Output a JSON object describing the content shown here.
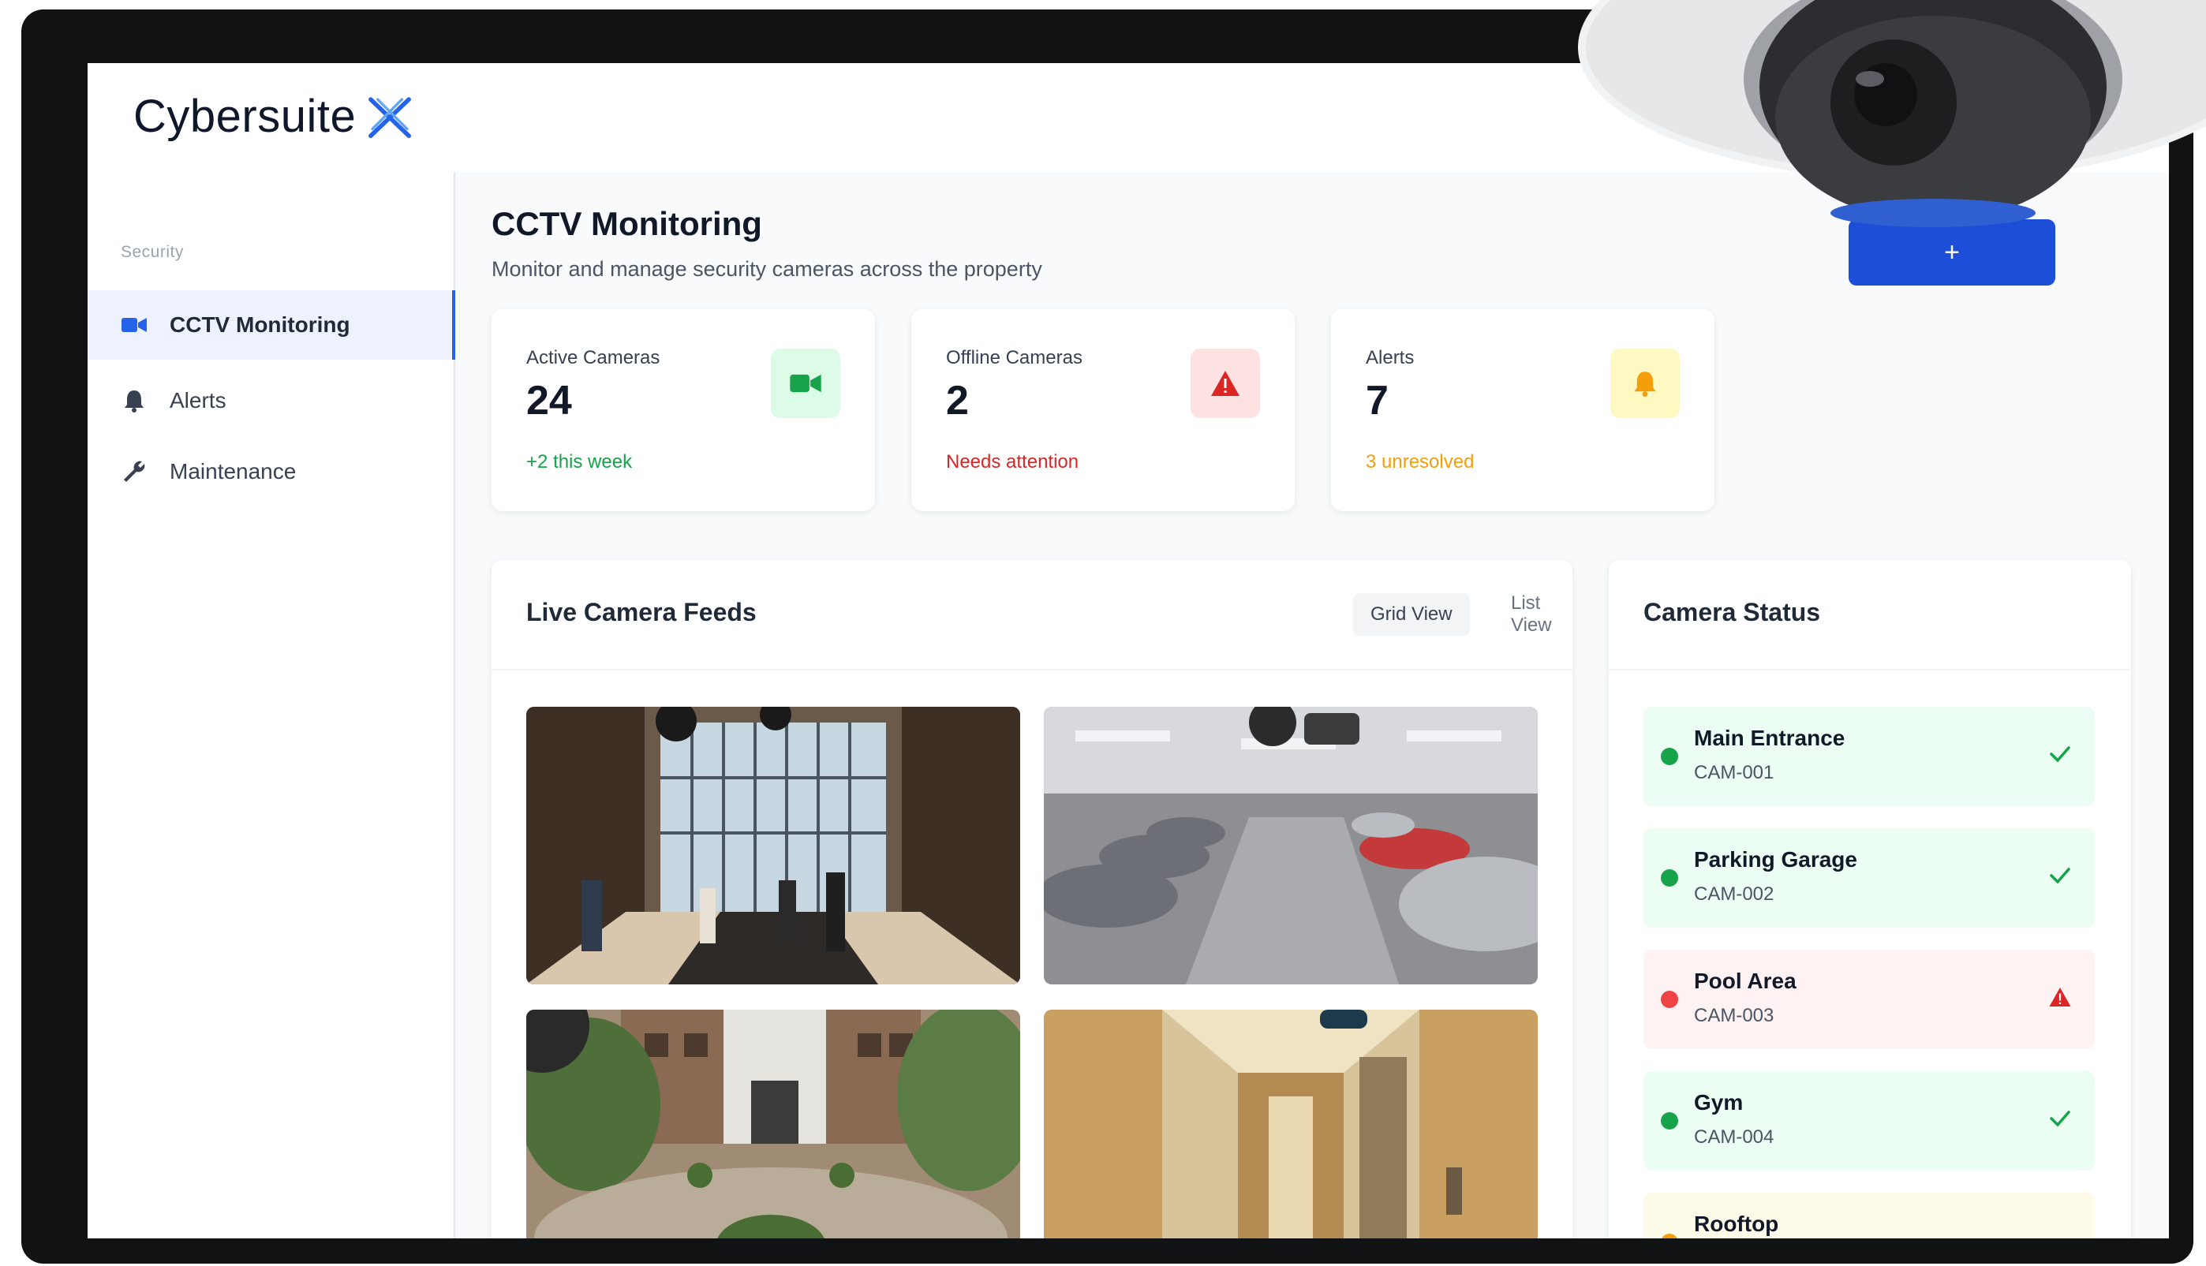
{
  "brand": {
    "name": "Cybersuite",
    "accent": "#2563eb"
  },
  "sidebar": {
    "section": "Security",
    "items": [
      {
        "label": "CCTV Monitoring",
        "icon": "video-camera-icon",
        "active": true
      },
      {
        "label": "Alerts",
        "icon": "bell-icon",
        "active": false
      },
      {
        "label": "Maintenance",
        "icon": "wrench-icon",
        "active": false
      }
    ]
  },
  "header": {
    "title": "CCTV Monitoring",
    "subtitle": "Monitor and manage security cameras across the property"
  },
  "stats": [
    {
      "label": "Active Cameras",
      "value": "24",
      "note": "+2 this week",
      "color": "#16a34a",
      "icon": "video-camera-icon"
    },
    {
      "label": "Offline Cameras",
      "value": "2",
      "note": "Needs attention",
      "color": "#dc2626",
      "icon": "warning-icon"
    },
    {
      "label": "Alerts",
      "value": "7",
      "note": "3 unresolved",
      "color": "#f59e0b",
      "icon": "bell-icon"
    }
  ],
  "feeds": {
    "title": "Live Camera Feeds",
    "grid_view": "Grid View",
    "list_view": "List View",
    "items": [
      {
        "name": "lobby-feed"
      },
      {
        "name": "parking-garage-feed"
      },
      {
        "name": "courtyard-feed"
      },
      {
        "name": "hallway-feed"
      }
    ]
  },
  "camera_status": {
    "title": "Camera Status",
    "cameras": [
      {
        "name": "Main Entrance",
        "id": "CAM-001",
        "status": "online"
      },
      {
        "name": "Parking Garage",
        "id": "CAM-002",
        "status": "online"
      },
      {
        "name": "Pool Area",
        "id": "CAM-003",
        "status": "offline"
      },
      {
        "name": "Gym",
        "id": "CAM-004",
        "status": "online"
      },
      {
        "name": "Rooftop",
        "id": "",
        "status": "warning"
      }
    ]
  },
  "status_colors": {
    "online": "#16a34a",
    "offline": "#ef4444",
    "warning": "#f59e0b"
  }
}
